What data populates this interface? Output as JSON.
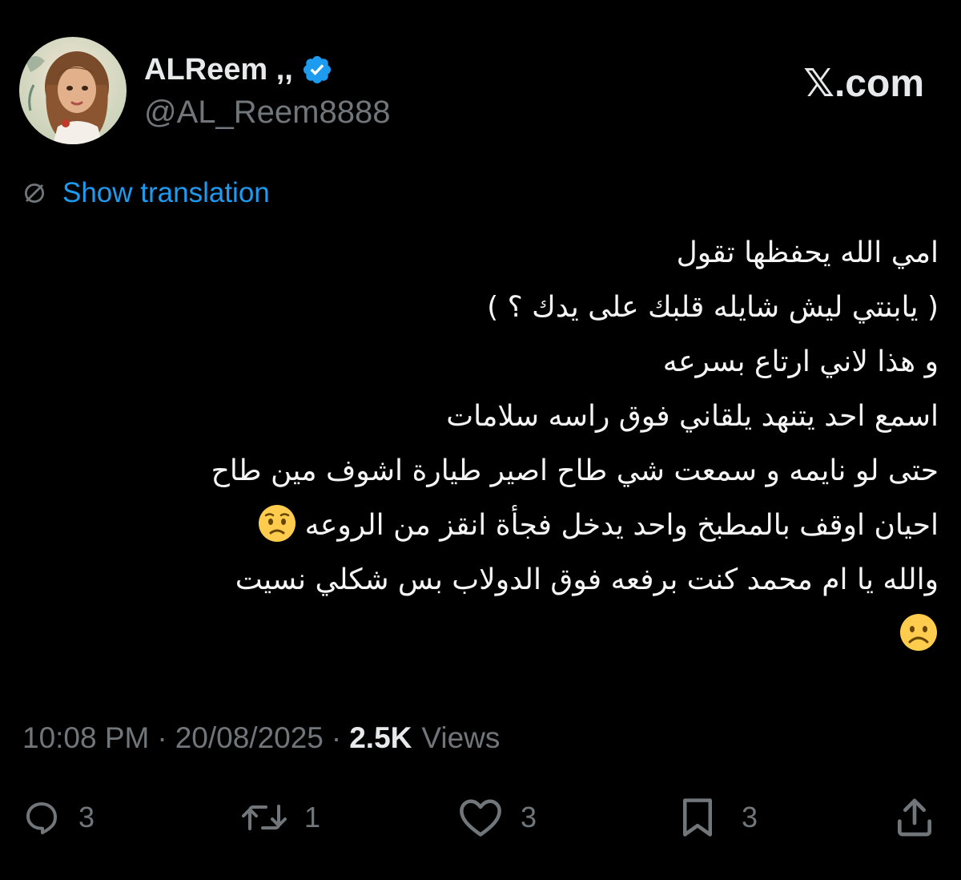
{
  "author": {
    "display_name": "ALReem ,,",
    "handle": "@AL_Reem8888",
    "verified_icon": "verified-badge-icon",
    "avatar": "avatar-illustration"
  },
  "brand": "𝕏.com",
  "translation": {
    "icon": "globe-icon",
    "label": "Show translation"
  },
  "tweet": {
    "lines": [
      "امي الله يحفظها تقول",
      "( يابنتي ليش شايله قلبك على يدك ؟ )",
      "و هذا لاني ارتاع بسرعه",
      "اسمع احد يتنهد يلقاني فوق راسه سلامات",
      "حتى لو نايمه و سمعت شي طاح اصير طيارة اشوف مين طاح",
      "احيان اوقف بالمطبخ واحد يدخل فجأة انقز من الروعه",
      "والله يا ام محمد كنت برفعه فوق الدولاب بس شكلي نسيت"
    ],
    "emojis": [
      "worried-face-emoji",
      "frowning-face-emoji"
    ]
  },
  "meta": {
    "time": "10:08 PM",
    "separator": "·",
    "date": "20/08/2025",
    "views_count": "2.5K",
    "views_label": "Views"
  },
  "actions": {
    "reply": {
      "icon": "reply-icon",
      "count": "3"
    },
    "repost": {
      "icon": "repost-icon",
      "count": "1"
    },
    "like": {
      "icon": "heart-icon",
      "count": "3"
    },
    "bookmark": {
      "icon": "bookmark-icon",
      "count": "3"
    },
    "share": {
      "icon": "share-icon"
    }
  },
  "colors": {
    "background": "#000000",
    "primary_text": "#e7e9ea",
    "secondary_text": "#71767b",
    "link": "#1d9bf0",
    "verified": "#1d9bf0"
  }
}
